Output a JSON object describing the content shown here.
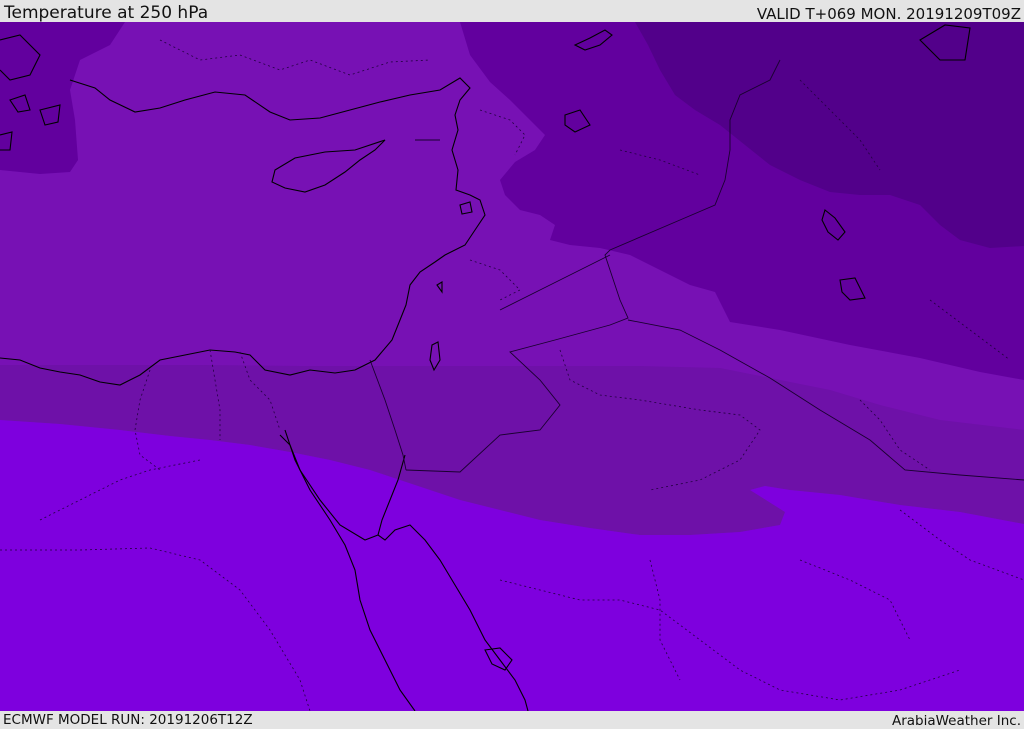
{
  "header": {
    "title": "Temperature at 250 hPa",
    "valid": "VALID T+069 MON. 20191209T09Z"
  },
  "footer": {
    "model_run": "ECMWF MODEL RUN: 20191206T12Z",
    "credit": "ArabiaWeather Inc."
  },
  "map": {
    "colors": {
      "band_coldest": "#52008a",
      "band_cold": "#62009e",
      "band_mid": "#7711b4",
      "band_warm": "#6e11a8",
      "band_warmest": "#7e00de",
      "coastline": "#000000",
      "border": "#1a0030"
    }
  }
}
